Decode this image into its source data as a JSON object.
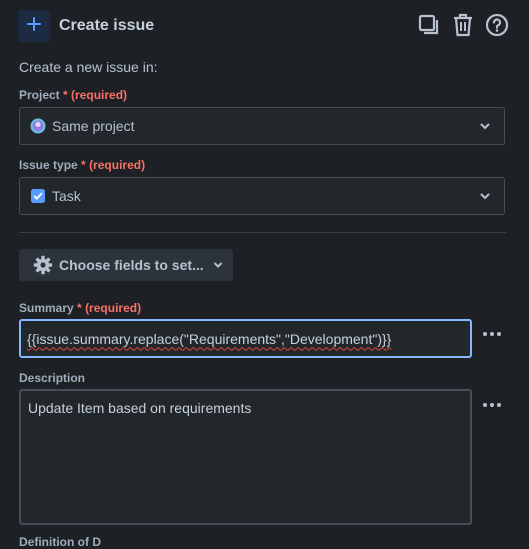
{
  "header": {
    "title": "Create issue",
    "icons": [
      "plus-icon",
      "copy-icon",
      "trash-icon",
      "help-icon"
    ]
  },
  "intro": "Create a new issue in:",
  "project": {
    "label": "Project",
    "required_mark": "*",
    "required_text": "(required)",
    "value": "Same project"
  },
  "issue_type": {
    "label": "Issue type",
    "required_mark": "*",
    "required_text": "(required)",
    "value": "Task"
  },
  "choose_fields": {
    "label": "Choose fields to set..."
  },
  "summary": {
    "label": "Summary",
    "required_mark": "*",
    "required_text": "(required)",
    "value": "{{issue.summary.replace(\"Requirements\",\"Development\")}}"
  },
  "description": {
    "label": "Description",
    "value": "Update Item based on requirements"
  },
  "next_field_label": "Definition of D",
  "colors": {
    "background": "#1d2125",
    "accent_focus": "#85b8ff",
    "required": "#f87168",
    "checkbox": "#579dff"
  }
}
